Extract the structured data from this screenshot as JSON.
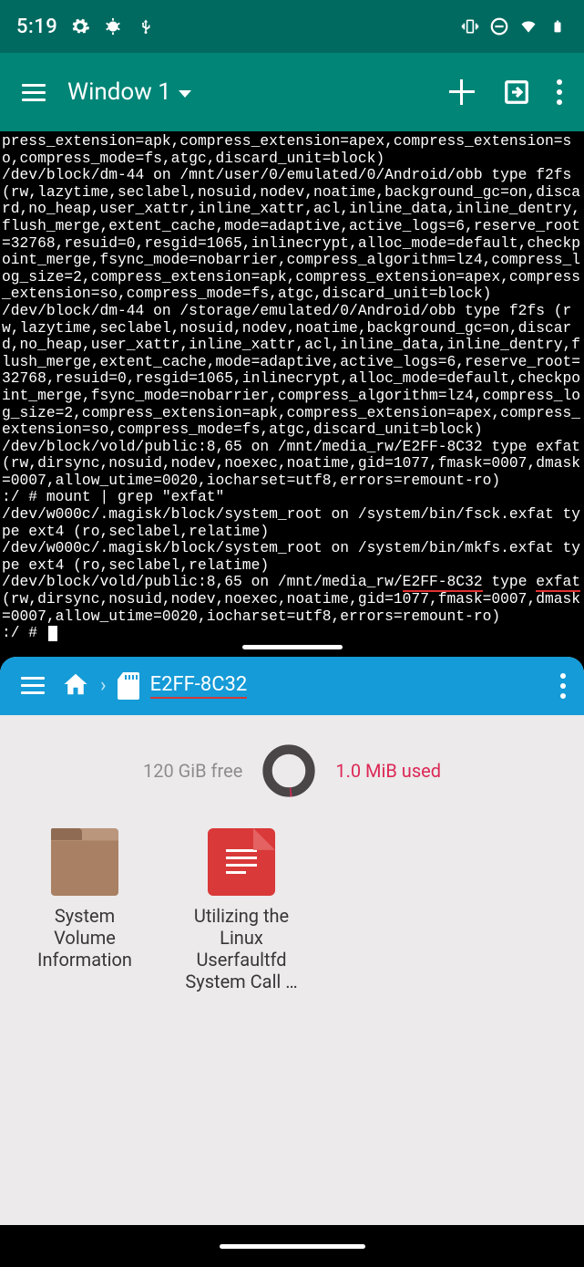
{
  "statusbar": {
    "time": "5:19",
    "icons_left": [
      "gear-icon",
      "bug-icon",
      "usb-icon"
    ],
    "icons_right": [
      "vibrate-icon",
      "dnd-icon",
      "wifi-icon",
      "battery-icon"
    ]
  },
  "appbar": {
    "title": "Window 1"
  },
  "terminal": {
    "lines": [
      "press_extension=apk,compress_extension=apex,compress_extension=so,compress_mode=fs,atgc,discard_unit=block)",
      "/dev/block/dm-44 on /mnt/user/0/emulated/0/Android/obb type f2fs (rw,lazytime,seclabel,nosuid,nodev,noatime,background_gc=on,discard,no_heap,user_xattr,inline_xattr,acl,inline_data,inline_dentry,flush_merge,extent_cache,mode=adaptive,active_logs=6,reserve_root=32768,resuid=0,resgid=1065,inlinecrypt,alloc_mode=default,checkpoint_merge,fsync_mode=nobarrier,compress_algorithm=lz4,compress_log_size=2,compress_extension=apk,compress_extension=apex,compress_extension=so,compress_mode=fs,atgc,discard_unit=block)",
      "/dev/block/dm-44 on /storage/emulated/0/Android/obb type f2fs (rw,lazytime,seclabel,nosuid,nodev,noatime,background_gc=on,discard,no_heap,user_xattr,inline_xattr,acl,inline_data,inline_dentry,flush_merge,extent_cache,mode=adaptive,active_logs=6,reserve_root=32768,resuid=0,resgid=1065,inlinecrypt,alloc_mode=default,checkpoint_merge,fsync_mode=nobarrier,compress_algorithm=lz4,compress_log_size=2,compress_extension=apk,compress_extension=apex,compress_extension=so,compress_mode=fs,atgc,discard_unit=block)",
      "/dev/block/vold/public:8,65 on /mnt/media_rw/E2FF-8C32 type exfat (rw,dirsync,nosuid,nodev,noexec,noatime,gid=1077,fmask=0007,dmask=0007,allow_utime=0020,iocharset=utf8,errors=remount-ro)",
      ":/ # mount | grep \"exfat\"",
      "/dev/w000c/.magisk/block/system_root on /system/bin/fsck.exfat type ext4 (ro,seclabel,relatime)",
      "/dev/w000c/.magisk/block/system_root on /system/bin/mkfs.exfat type ext4 (ro,seclabel,relatime)"
    ],
    "highlighted_line_prefix": "/dev/block/vold/public:8,65 on /mnt/media_rw/",
    "highlighted_volume": "E2FF-8C32",
    "highlighted_mid": " type ",
    "highlighted_fs": "exfat",
    "highlighted_suffix": " (rw,dirsync,nosuid,nodev,noexec,noatime,gid=1077,fmask=0007,dmask=0007,allow_utime=0020,iocharset=utf8,errors=remount-ro)",
    "prompt": ":/ # "
  },
  "filemanager": {
    "location": "E2FF-8C32",
    "free_label": "120 GiB free",
    "used_label": "1.0 MiB used",
    "items": [
      {
        "type": "folder",
        "label": "System Volume Information"
      },
      {
        "type": "document",
        "label": "Utilizing the Linux Userfaultfd System Call …"
      }
    ]
  }
}
